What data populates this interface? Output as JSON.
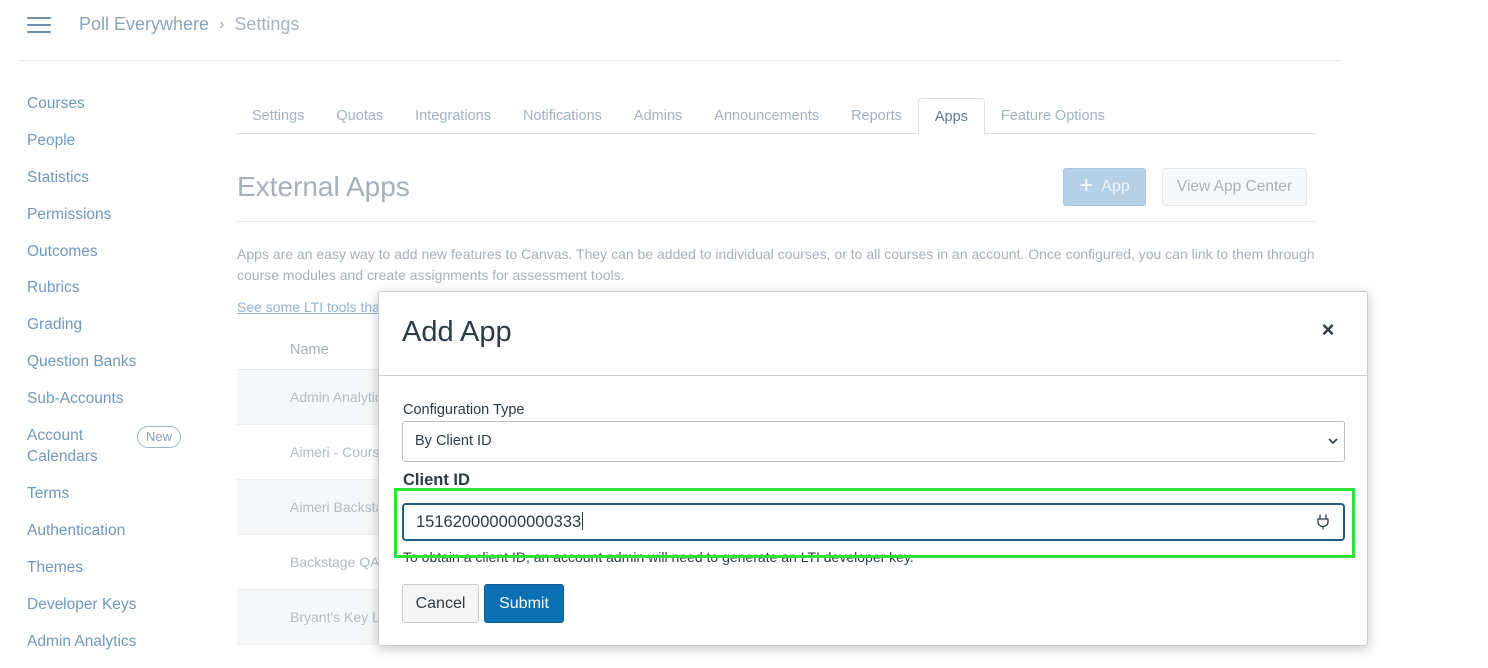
{
  "header": {
    "breadcrumb": [
      "Poll Everywhere",
      "Settings"
    ],
    "breadcrumb_separator": "›"
  },
  "sidebar": {
    "items": [
      {
        "label": "Courses"
      },
      {
        "label": "People"
      },
      {
        "label": "Statistics"
      },
      {
        "label": "Permissions"
      },
      {
        "label": "Outcomes"
      },
      {
        "label": "Rubrics"
      },
      {
        "label": "Grading"
      },
      {
        "label": "Question Banks"
      },
      {
        "label": "Sub-Accounts"
      },
      {
        "label": "Account Calendars",
        "badge": "New"
      },
      {
        "label": "Terms"
      },
      {
        "label": "Authentication"
      },
      {
        "label": "Themes"
      },
      {
        "label": "Developer Keys"
      },
      {
        "label": "Admin Analytics"
      }
    ]
  },
  "tabs": [
    {
      "label": "Settings"
    },
    {
      "label": "Quotas"
    },
    {
      "label": "Integrations"
    },
    {
      "label": "Notifications"
    },
    {
      "label": "Admins"
    },
    {
      "label": "Announcements"
    },
    {
      "label": "Reports"
    },
    {
      "label": "Apps",
      "active": true
    },
    {
      "label": "Feature Options"
    }
  ],
  "main": {
    "title": "External Apps",
    "add_app_label": "App",
    "view_app_center_label": "View App Center",
    "description": "Apps are an easy way to add new features to Canvas. They can be added to individual courses, or to all courses in an account. Once configured, you can link to them through course modules and create assignments for assessment tools.",
    "lti_link": "See some LTI tools tha"
  },
  "table": {
    "header_name": "Name",
    "rows": [
      "Admin Analytic",
      "Aimeri - Cours",
      "Aimeri Backsta",
      "Backstage QA",
      "Bryant's Key L"
    ]
  },
  "modal": {
    "title": "Add App",
    "close_symbol": "×",
    "config_type_label": "Configuration Type",
    "config_type_value": "By Client ID",
    "client_id_label": "Client ID",
    "client_id_value": "151620000000000333",
    "help_text": "To obtain a client ID, an account admin will need to generate an LTI developer key.",
    "cancel_label": "Cancel",
    "submit_label": "Submit"
  },
  "colors": {
    "primary_button": "#0b6fb2",
    "focus_border": "#1f5f86",
    "highlight": "#2fe23a",
    "link": "#6e98bf"
  }
}
